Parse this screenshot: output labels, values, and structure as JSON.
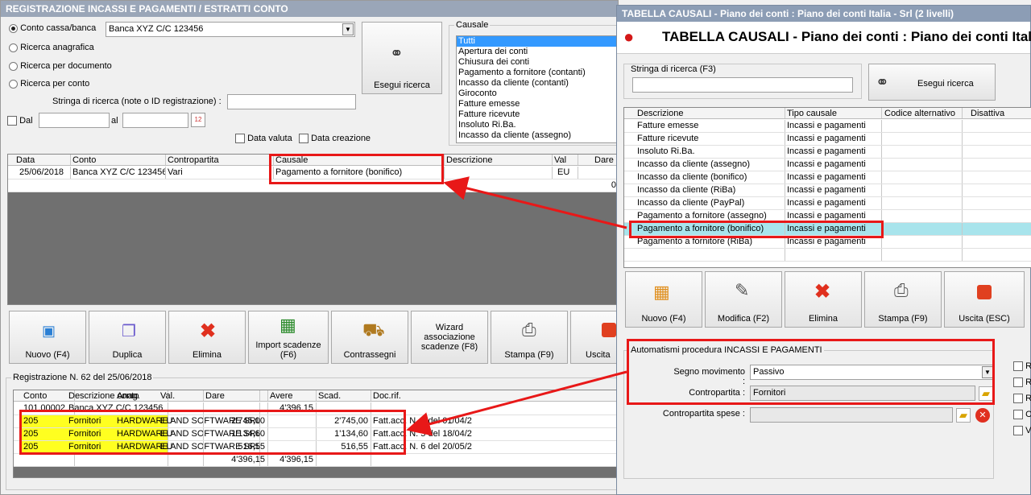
{
  "win1": {
    "title": "REGISTRAZIONE INCASSI E PAGAMENTI / ESTRATTI CONTO",
    "radios": [
      "Conto cassa/banca",
      "Ricerca anagrafica",
      "Ricerca per documento",
      "Ricerca per conto"
    ],
    "account_select": "Banca XYZ C/C 123456",
    "search_label": "Stringa di ricerca (note o ID registrazione) :",
    "search_value": "",
    "dal_label": "Dal",
    "al_label": "al",
    "data_valuta": "Data valuta",
    "data_creazione": "Data creazione",
    "search_button": "Esegui ricerca",
    "causale_label": "Causale",
    "causale_items": [
      "Tutti",
      "Apertura dei conti",
      "Chiusura dei conti",
      "Pagamento a fornitore (contanti)",
      "Incasso da cliente (contanti)",
      "Giroconto",
      "Fatture emesse",
      "Fatture ricevute",
      "Insoluto Ri.Ba.",
      "Incasso da cliente (assegno)"
    ],
    "grid": {
      "headers": [
        "Data",
        "Conto",
        "Contropartita",
        "Causale",
        "Descrizione",
        "Val",
        "Dare"
      ],
      "row": [
        "25/06/2018",
        "Banca XYZ C/C 123456",
        "Vari",
        "Pagamento a fornitore (bonifico)",
        "",
        "EU",
        ""
      ],
      "total": "0"
    },
    "toolbar": [
      "Nuovo (F4)",
      "Duplica",
      "Elimina",
      "Import scadenze (F6)",
      "Contrassegni",
      "Wizard associazione scadenze (F8)",
      "Stampa (F9)",
      "Uscita"
    ],
    "reg_label": "Registrazione N. 62 del 25/06/2018",
    "reg_grid": {
      "headers": [
        "Conto",
        "Descrizione conto",
        "Anag.",
        "Val.",
        "Dare",
        "Avere",
        "Scad.",
        "Doc.rif."
      ],
      "rows": [
        [
          "101.00002",
          "Banca XYZ C/C 123456",
          "",
          "",
          "",
          "4'396,15",
          "",
          ""
        ],
        [
          "205",
          "Fornitori",
          "HARDWARE AND SOFTWARE SRL",
          "EU",
          "2'745,00",
          "",
          "2'745,00",
          "Fatt.acc. N. 4 del 01/04/2"
        ],
        [
          "205",
          "Fornitori",
          "HARDWARE AND SOFTWARE SRL",
          "EU",
          "1'134,60",
          "",
          "1'134,60",
          "Fatt.acc. N. 5 del 18/04/2"
        ],
        [
          "205",
          "Fornitori",
          "HARDWARE AND SOFTWARE SRL",
          "EU",
          "516,55",
          "",
          "516,55",
          "Fatt.acc. N. 6 del 20/05/2"
        ],
        [
          "",
          "",
          "",
          "",
          "4'396,15",
          "4'396,15",
          "",
          ""
        ]
      ]
    }
  },
  "win2": {
    "title": "TABELLA CAUSALI - Piano dei conti : Piano dei conti Italia - Srl (2 livelli)",
    "header": "TABELLA CAUSALI - Piano dei conti : Piano dei conti Italia - S",
    "search_label": "Stringa di ricerca (F3)",
    "search_button": "Esegui ricerca",
    "grid": {
      "headers": [
        "Descrizione",
        "Tipo causale",
        "Codice alternativo",
        "Disattiva"
      ],
      "rows": [
        [
          "Fatture emesse",
          "Incassi e pagamenti"
        ],
        [
          "Fatture ricevute",
          "Incassi e pagamenti"
        ],
        [
          "Insoluto Ri.Ba.",
          "Incassi e pagamenti"
        ],
        [
          "Incasso da cliente (assegno)",
          "Incassi e pagamenti"
        ],
        [
          "Incasso da cliente (bonifico)",
          "Incassi e pagamenti"
        ],
        [
          "Incasso da cliente (RiBa)",
          "Incassi e pagamenti"
        ],
        [
          "Incasso da cliente (PayPal)",
          "Incassi e pagamenti"
        ],
        [
          "Pagamento a fornitore (assegno)",
          "Incassi e pagamenti"
        ],
        [
          "Pagamento a fornitore (bonifico)",
          "Incassi e pagamenti"
        ],
        [
          "Pagamento a fornitore (RiBa)",
          "Incassi e pagamenti"
        ]
      ]
    },
    "toolbar": [
      "Nuovo (F4)",
      "Modifica (F2)",
      "Elimina",
      "Stampa (F9)",
      "Uscita (ESC)"
    ],
    "group_label": "Automatismi procedura INCASSI E PAGAMENTI",
    "segno_label": "Segno movimento :",
    "segno_value": "Passivo",
    "contro_label": "Contropartita :",
    "contro_value": "Fornitori",
    "spese_label": "Contropartita spese :",
    "spese_value": "",
    "side_checks": [
      "Ri",
      "Ri",
      "Ri",
      "Ca",
      "Vi"
    ]
  },
  "colors": {
    "highlight_red": "#e81818",
    "yellow": "#ffff20",
    "selected_row": "#a8e4ec"
  }
}
